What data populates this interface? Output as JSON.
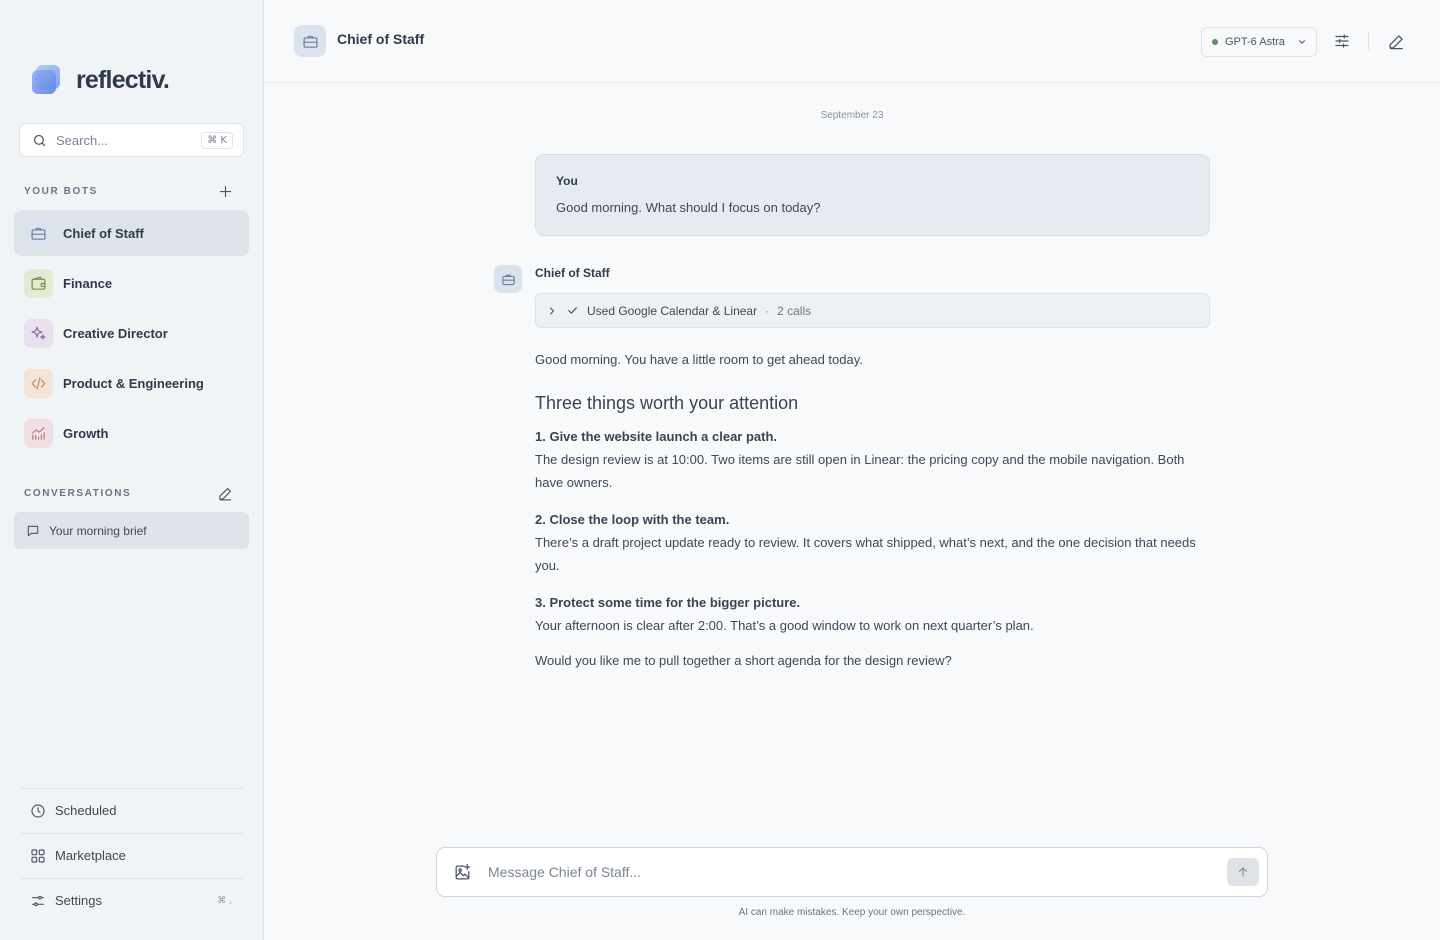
{
  "app": {
    "brand": "reflectiv."
  },
  "search": {
    "placeholder": "Search...",
    "shortcut": "⌘ K"
  },
  "bots": {
    "section_label": "YOUR BOTS",
    "items": [
      {
        "label": "Chief of Staff",
        "icon": "briefcase-icon",
        "active": true,
        "color": "#dbe4ee"
      },
      {
        "label": "Finance",
        "icon": "wallet-icon",
        "active": false,
        "color": "#e2ebd3"
      },
      {
        "label": "Creative Director",
        "icon": "sparkles-icon",
        "active": false,
        "color": "#e9e1ef"
      },
      {
        "label": "Product & Engineering",
        "icon": "code-icon",
        "active": false,
        "color": "#f3e3d8"
      },
      {
        "label": "Growth",
        "icon": "chart-icon",
        "active": false,
        "color": "#f2dfe3"
      }
    ]
  },
  "conversations": {
    "section_label": "CONVERSATIONS",
    "items": [
      {
        "label": "Your morning brief",
        "active": true
      }
    ]
  },
  "bottom_nav": {
    "scheduled": "Scheduled",
    "marketplace": "Marketplace",
    "settings": "Settings",
    "settings_shortcut": "⌘ ,"
  },
  "topbar": {
    "title": "Chief of Staff",
    "model": "GPT-6 Astra",
    "model_status_color": "#5f8f6a"
  },
  "chat": {
    "date": "September 23",
    "user": {
      "name": "You",
      "message": "Good morning. What should I focus on today?"
    },
    "assistant": {
      "name": "Chief of Staff",
      "tool_use": {
        "label": "Used Google Calendar & Linear",
        "separator": "·",
        "calls": "2 calls"
      },
      "intro": "Good morning. You have a little room to get ahead today.",
      "heading": "Three things worth your attention",
      "items": [
        {
          "title": "1. Give the website launch a clear path.",
          "body": "The design review is at 10:00. Two items are still open in Linear: the pricing copy and the mobile navigation. Both have owners."
        },
        {
          "title": "2. Close the loop with the team.",
          "body": "There’s a draft project update ready to review. It covers what shipped, what’s next, and the one decision that needs you."
        },
        {
          "title": "3. Protect some time for the bigger picture.",
          "body": "Your afternoon is clear after 2:00. That’s a good window to work on next quarter’s plan."
        }
      ],
      "closing": "Would you like me to pull together a short agenda for the design review?"
    }
  },
  "composer": {
    "placeholder": "Message Chief of Staff...",
    "disclaimer": "AI can make mistakes. Keep your own perspective."
  }
}
